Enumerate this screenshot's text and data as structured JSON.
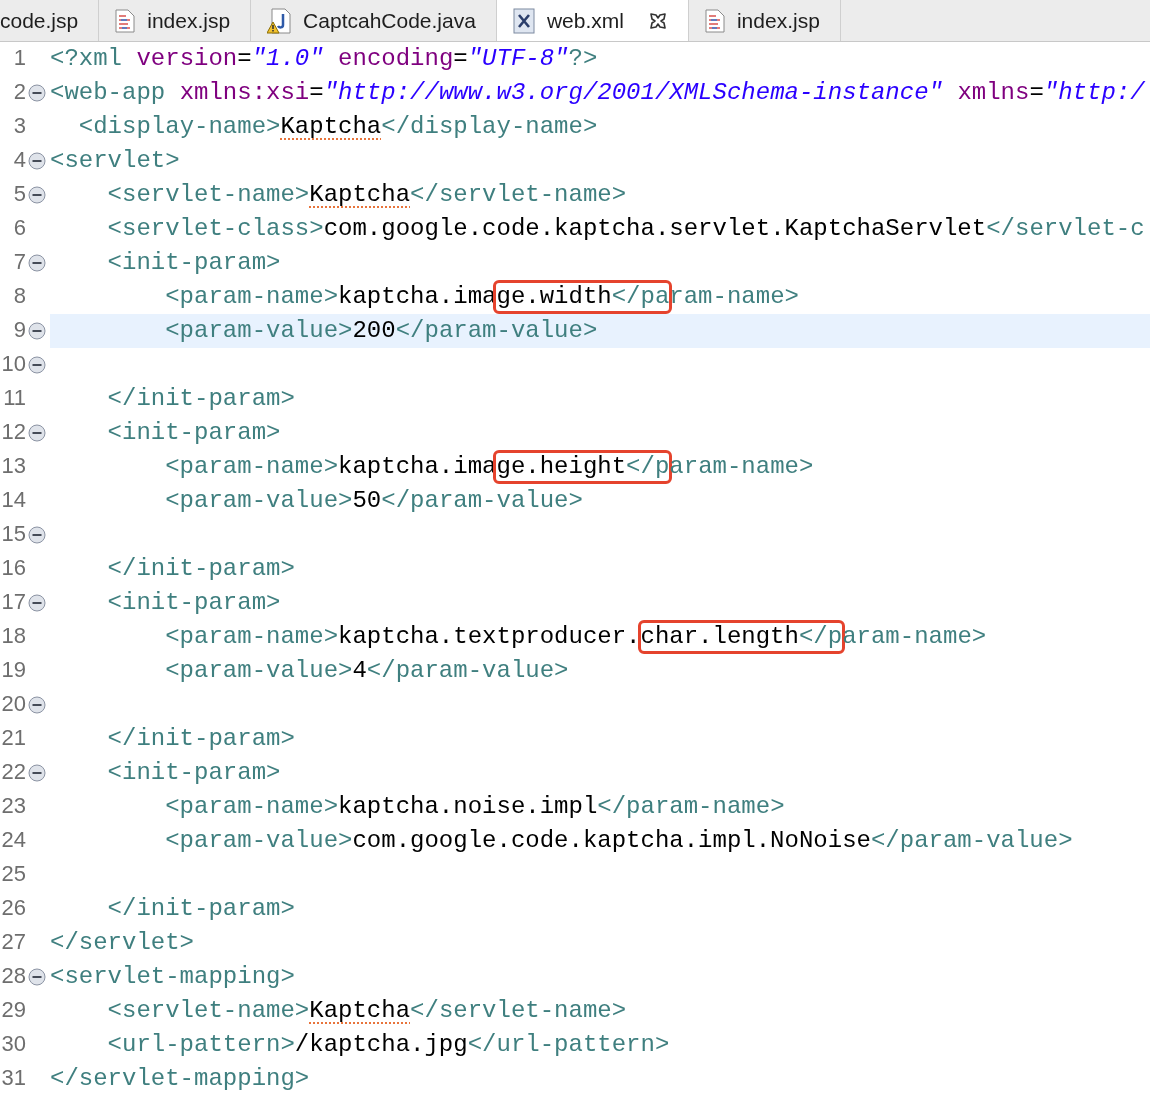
{
  "tabs": [
    {
      "label": "code.jsp",
      "selected": false,
      "closable": false
    },
    {
      "label": "index.jsp",
      "kind": "jsp",
      "selected": false,
      "closable": false
    },
    {
      "label": "CaptcahCode.java",
      "kind": "java",
      "selected": false,
      "closable": false
    },
    {
      "label": "web.xml",
      "kind": "xml",
      "selected": true,
      "closable": true
    },
    {
      "label": "index.jsp",
      "kind": "jsp",
      "selected": false,
      "closable": false
    }
  ],
  "lines": [
    {
      "number": "1",
      "fold": false,
      "current": false,
      "segments": [
        {
          "kind": "tag",
          "text": "<?xml",
          "misspelled": false
        },
        {
          "kind": "attr",
          "text": " version",
          "misspelled": false
        },
        {
          "kind": "punct",
          "text": "=",
          "misspelled": false
        },
        {
          "kind": "string",
          "text": "\"1.0\"",
          "misspelled": false
        },
        {
          "kind": "attr",
          "text": " encoding",
          "misspelled": false
        },
        {
          "kind": "punct",
          "text": "=",
          "misspelled": false
        },
        {
          "kind": "string",
          "text": "\"UTF-8\"",
          "misspelled": false
        },
        {
          "kind": "tag",
          "text": "?>",
          "misspelled": false
        }
      ]
    },
    {
      "number": "2",
      "fold": true,
      "current": false,
      "segments": [
        {
          "kind": "tag",
          "text": "<web-app",
          "misspelled": false
        },
        {
          "kind": "attr",
          "text": " xmlns:xsi",
          "misspelled": false
        },
        {
          "kind": "punct",
          "text": "=",
          "misspelled": false
        },
        {
          "kind": "string",
          "text": "\"http://www.w3.org/2001/XMLSchema-instance\"",
          "misspelled": false
        },
        {
          "kind": "attr",
          "text": " xmlns",
          "misspelled": false
        },
        {
          "kind": "punct",
          "text": "=",
          "misspelled": false
        },
        {
          "kind": "string",
          "text": "\"http:/",
          "misspelled": false
        }
      ]
    },
    {
      "number": "3",
      "fold": false,
      "current": false,
      "segments": [
        {
          "kind": "tag",
          "text": "  <display-name>",
          "misspelled": false
        },
        {
          "kind": "text",
          "text": "Kaptcha",
          "misspelled": true
        },
        {
          "kind": "tag",
          "text": "</display-name>",
          "misspelled": false
        }
      ]
    },
    {
      "number": "4",
      "fold": true,
      "current": false,
      "segments": [
        {
          "kind": "tag",
          "text": "<servlet>",
          "misspelled": false
        }
      ]
    },
    {
      "number": "5",
      "fold": true,
      "current": false,
      "segments": [
        {
          "kind": "tag",
          "text": "    <servlet-name>",
          "misspelled": false
        },
        {
          "kind": "text",
          "text": "Kaptcha",
          "misspelled": true
        },
        {
          "kind": "tag",
          "text": "</servlet-name>",
          "misspelled": false
        }
      ]
    },
    {
      "number": "6",
      "fold": false,
      "current": false,
      "segments": [
        {
          "kind": "tag",
          "text": "    <servlet-class>",
          "misspelled": false
        },
        {
          "kind": "text",
          "text": "com.google.code.kaptcha.servlet.KaptchaServlet",
          "misspelled": false
        },
        {
          "kind": "tag",
          "text": "</servlet-c",
          "misspelled": false
        }
      ]
    },
    {
      "number": "7",
      "fold": true,
      "current": false,
      "segments": [
        {
          "kind": "tag",
          "text": "    <init-param>",
          "misspelled": false
        }
      ]
    },
    {
      "number": "8",
      "fold": false,
      "current": false,
      "segments": [
        {
          "kind": "tag",
          "text": "        <param-name>",
          "misspelled": false
        },
        {
          "kind": "text",
          "text": "kaptcha.ima",
          "misspelled": false
        },
        {
          "kind": "annotation",
          "segments": [
            {
              "kind": "text",
              "text": "ge.width",
              "misspelled": false
            },
            {
              "kind": "tag",
              "text": "</pa",
              "misspelled": false
            }
          ]
        },
        {
          "kind": "tag",
          "text": "ram-name>",
          "misspelled": false
        }
      ]
    },
    {
      "number": "9",
      "fold": true,
      "current": true,
      "segments": [
        {
          "kind": "tag",
          "text": "        <param-value>",
          "misspelled": false
        },
        {
          "kind": "text",
          "text": "200",
          "misspelled": false
        },
        {
          "kind": "tag",
          "text": "</param-value>",
          "misspelled": false
        }
      ]
    },
    {
      "number": "10",
      "fold": true,
      "current": false
    },
    {
      "number": "11",
      "fold": false,
      "current": false,
      "segments": [
        {
          "kind": "tag",
          "text": "    </init-param>",
          "misspelled": false
        }
      ]
    },
    {
      "number": "12",
      "fold": true,
      "current": false,
      "segments": [
        {
          "kind": "tag",
          "text": "    <init-param>",
          "misspelled": false
        }
      ]
    },
    {
      "number": "13",
      "fold": false,
      "current": false,
      "segments": [
        {
          "kind": "tag",
          "text": "        <param-name>",
          "misspelled": false
        },
        {
          "kind": "text",
          "text": "kaptcha.ima",
          "misspelled": false
        },
        {
          "kind": "annotation",
          "segments": [
            {
              "kind": "text",
              "text": "ge.height",
              "misspelled": false
            },
            {
              "kind": "tag",
              "text": "</p",
              "misspelled": false
            }
          ]
        },
        {
          "kind": "tag",
          "text": "aram-name>",
          "misspelled": false
        }
      ]
    },
    {
      "number": "14",
      "fold": false,
      "current": false,
      "segments": [
        {
          "kind": "tag",
          "text": "        <param-value>",
          "misspelled": false
        },
        {
          "kind": "text",
          "text": "50",
          "misspelled": false
        },
        {
          "kind": "tag",
          "text": "</param-value>",
          "misspelled": false
        }
      ]
    },
    {
      "number": "15",
      "fold": true,
      "current": false
    },
    {
      "number": "16",
      "fold": false,
      "current": false,
      "segments": [
        {
          "kind": "tag",
          "text": "    </init-param>",
          "misspelled": false
        }
      ]
    },
    {
      "number": "17",
      "fold": true,
      "current": false,
      "segments": [
        {
          "kind": "tag",
          "text": "    <init-param>",
          "misspelled": false
        }
      ]
    },
    {
      "number": "18",
      "fold": false,
      "current": false,
      "segments": [
        {
          "kind": "tag",
          "text": "        <param-name>",
          "misspelled": false
        },
        {
          "kind": "text",
          "text": "kaptcha.textproducer.",
          "misspelled": false
        },
        {
          "kind": "annotation",
          "segments": [
            {
              "kind": "text",
              "text": "char.length",
              "misspelled": false
            },
            {
              "kind": "tag",
              "text": "</p",
              "misspelled": false
            }
          ]
        },
        {
          "kind": "tag",
          "text": "aram-name>",
          "misspelled": false
        }
      ]
    },
    {
      "number": "19",
      "fold": false,
      "current": false,
      "segments": [
        {
          "kind": "tag",
          "text": "        <param-value>",
          "misspelled": false
        },
        {
          "kind": "text",
          "text": "4",
          "misspelled": false
        },
        {
          "kind": "tag",
          "text": "</param-value>",
          "misspelled": false
        }
      ]
    },
    {
      "number": "20",
      "fold": true,
      "current": false
    },
    {
      "number": "21",
      "fold": false,
      "current": false,
      "segments": [
        {
          "kind": "tag",
          "text": "    </init-param>",
          "misspelled": false
        }
      ]
    },
    {
      "number": "22",
      "fold": true,
      "current": false,
      "segments": [
        {
          "kind": "tag",
          "text": "    <init-param>",
          "misspelled": false
        }
      ]
    },
    {
      "number": "23",
      "fold": false,
      "current": false,
      "segments": [
        {
          "kind": "tag",
          "text": "        <param-name>",
          "misspelled": false
        },
        {
          "kind": "text",
          "text": "kaptcha.noise.impl",
          "misspelled": false
        },
        {
          "kind": "tag",
          "text": "</param-name>",
          "misspelled": false
        }
      ]
    },
    {
      "number": "24",
      "fold": false,
      "current": false,
      "segments": [
        {
          "kind": "tag",
          "text": "        <param-value>",
          "misspelled": false
        },
        {
          "kind": "text",
          "text": "com.google.code.kaptcha.impl.NoNoise",
          "misspelled": false
        },
        {
          "kind": "tag",
          "text": "</param-value>",
          "misspelled": false
        }
      ]
    },
    {
      "number": "25",
      "fold": false,
      "current": false
    },
    {
      "number": "26",
      "fold": false,
      "current": false,
      "segments": [
        {
          "kind": "tag",
          "text": "    </init-param>",
          "misspelled": false
        }
      ]
    },
    {
      "number": "27",
      "fold": false,
      "current": false,
      "segments": [
        {
          "kind": "tag",
          "text": "</servlet>",
          "misspelled": false
        }
      ]
    },
    {
      "number": "28",
      "fold": true,
      "current": false,
      "segments": [
        {
          "kind": "tag",
          "text": "<servlet-mapping>",
          "misspelled": false
        }
      ]
    },
    {
      "number": "29",
      "fold": false,
      "current": false,
      "segments": [
        {
          "kind": "tag",
          "text": "    <servlet-name>",
          "misspelled": false
        },
        {
          "kind": "text",
          "text": "Kaptcha",
          "misspelled": true
        },
        {
          "kind": "tag",
          "text": "</servlet-name>",
          "misspelled": false
        }
      ]
    },
    {
      "number": "30",
      "fold": false,
      "current": false,
      "segments": [
        {
          "kind": "tag",
          "text": "    <url-pattern>",
          "misspelled": false
        },
        {
          "kind": "text",
          "text": "/kaptcha.jpg",
          "misspelled": false
        },
        {
          "kind": "tag",
          "text": "</url-pattern>",
          "misspelled": false
        }
      ]
    },
    {
      "number": "31",
      "fold": false,
      "current": false,
      "segments": [
        {
          "kind": "tag",
          "text": "</servlet-mapping>",
          "misspelled": false
        }
      ]
    }
  ]
}
